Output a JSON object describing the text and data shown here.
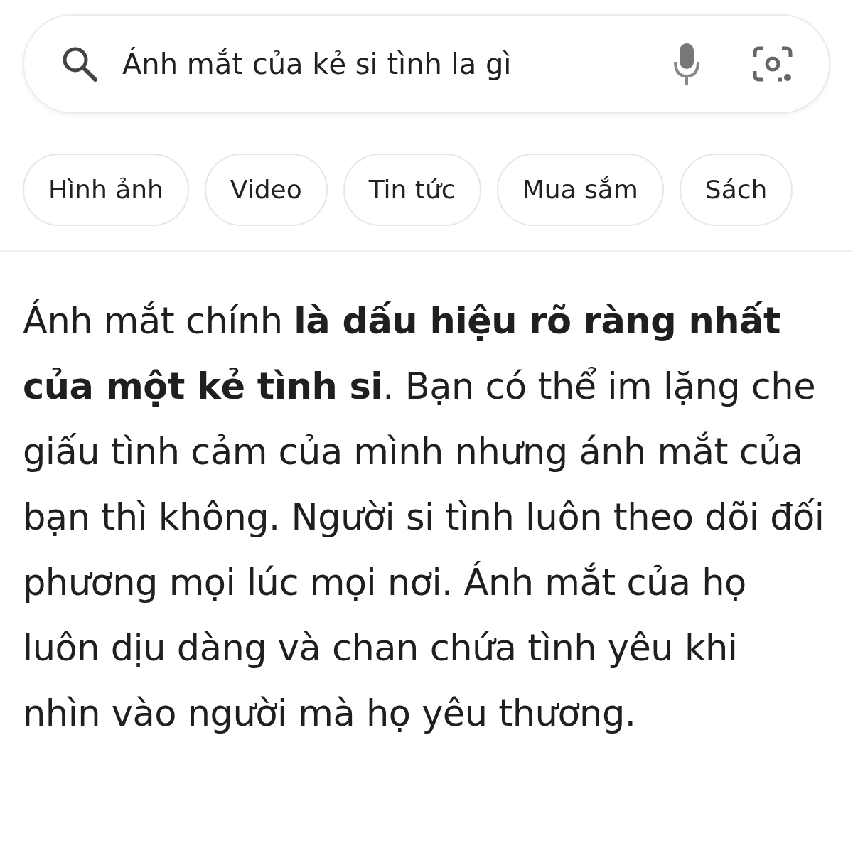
{
  "search": {
    "value": "Ánh mắt của kẻ si tình la gì"
  },
  "chips": [
    {
      "label": "Hình ảnh"
    },
    {
      "label": "Video"
    },
    {
      "label": "Tin tức"
    },
    {
      "label": "Mua sắm"
    },
    {
      "label": "Sách"
    }
  ],
  "answer": {
    "text": "Ánh mắt chính **là dấu hiệu rõ ràng nhất của một kẻ tình si**. Bạn có thể im lặng che giấu tình cảm của mình nhưng ánh mắt của bạn thì không. Người si tình luôn theo dõi đối phương mọi lúc mọi nơi. Ánh mắt của họ luôn dịu dàng và chan chứa tình yêu khi nhìn vào người mà họ yêu thương."
  }
}
